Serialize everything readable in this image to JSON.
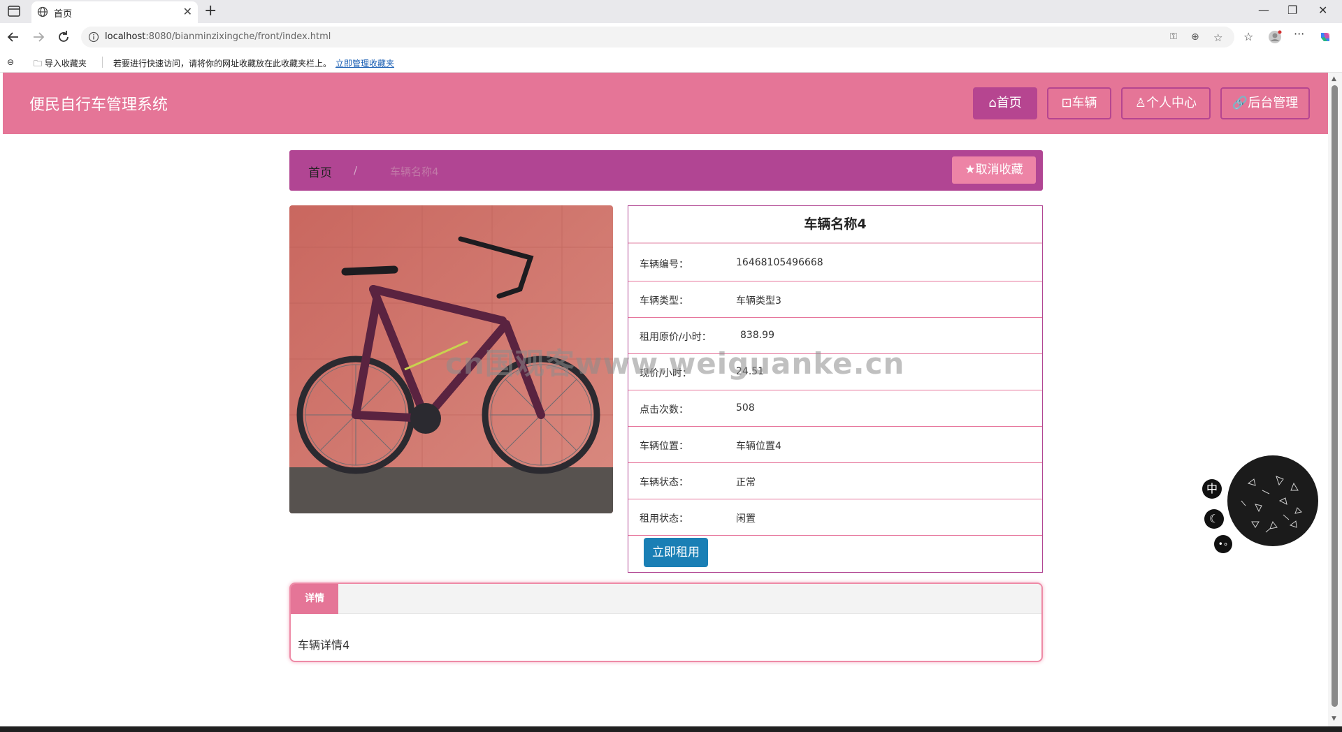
{
  "browser": {
    "tab_title": "首页",
    "url_host": "localhost",
    "url_rest": ":8080/bianminzixingche/front/index.html",
    "favorites_import": "导入收藏夹",
    "favorites_hint": "若要进行快速访问，请将你的网址收藏放在此收藏夹栏上。",
    "favorites_manage_link": "立即管理收藏夹"
  },
  "site": {
    "title": "便民自行车管理系统",
    "nav": [
      {
        "label": "首页",
        "icon": "home-icon",
        "active": true
      },
      {
        "label": "车辆",
        "icon": "bike-icon",
        "active": false
      },
      {
        "label": "个人中心",
        "icon": "user-icon",
        "active": false
      },
      {
        "label": "后台管理",
        "icon": "link-icon",
        "active": false
      }
    ]
  },
  "breadcrumb": {
    "home": "首页",
    "separator": "/",
    "current": "车辆名称4",
    "favorite_button": "取消收藏"
  },
  "vehicle": {
    "name": "车辆名称4",
    "rows": [
      {
        "key": "车辆编号：",
        "value": "16468105496668"
      },
      {
        "key": "车辆类型：",
        "value": "车辆类型3"
      },
      {
        "key": "租用原价/小时：",
        "value": "838.99"
      },
      {
        "key": "现价/小时：",
        "value": "24.51"
      },
      {
        "key": "点击次数：",
        "value": "508"
      },
      {
        "key": "车辆位置：",
        "value": "车辆位置4"
      },
      {
        "key": "车辆状态：",
        "value": "正常"
      },
      {
        "key": "租用状态：",
        "value": "闲置"
      }
    ],
    "rent_button": "立即租用"
  },
  "detail": {
    "tab": "详情",
    "content": "车辆详情4"
  },
  "watermark": "cn国观客www.weiguanke.cn",
  "float_tools": {
    "lang": "中",
    "theme_icon": "moon-icon",
    "misc_icon": "dots-icon"
  },
  "colors": {
    "header_pink": "#e57597",
    "accent_magenta": "#b14593",
    "button_pink": "#ed84a6",
    "rent_blue": "#1a7fb5"
  }
}
